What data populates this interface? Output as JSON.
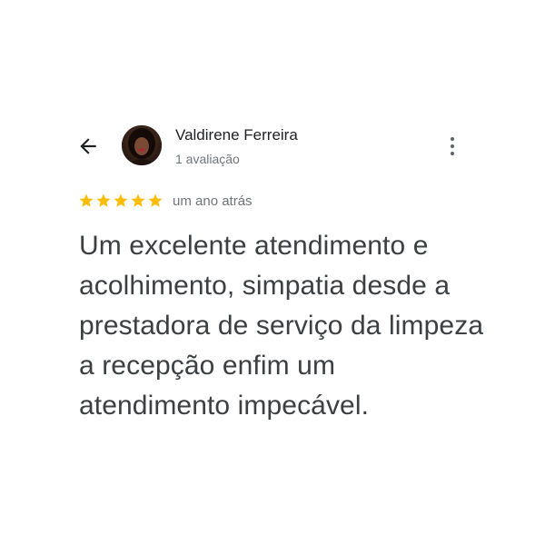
{
  "review": {
    "reviewer_name": "Valdirene Ferreira",
    "review_count": "1 avaliação",
    "rating": 5,
    "rating_max": 5,
    "date": "um ano atrás",
    "text": "Um excelente atendimento e acolhimento, simpatia desde a prestadora de serviço da limpeza a recepção enfim um atendimento impecável."
  },
  "icons": {
    "back": "arrow-back-icon",
    "more": "more-vert-icon",
    "star": "star-icon"
  },
  "colors": {
    "star": "#fbbc04",
    "text_primary": "#202124",
    "text_body": "#3c4043",
    "text_secondary": "#70757a"
  }
}
